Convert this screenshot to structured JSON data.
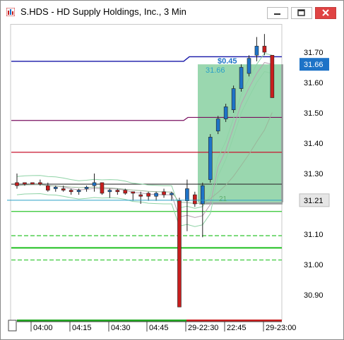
{
  "window": {
    "title": "S.HDS - HD Supply Holdings, Inc., 3 Min",
    "controls": [
      "minimize",
      "restore",
      "close"
    ]
  },
  "colors": {
    "up_candle": "#1e73c7",
    "down_candle": "#c81e1e",
    "green_zone": "#8fd3a6",
    "current_price_tag": "#1e73c7",
    "blue_line": "#1616a8",
    "purple_line": "#7a1060",
    "red_line": "#c8142d",
    "green_lines": "#2ec52e",
    "crosshair": "#2aa0c8"
  },
  "chart_data": {
    "type": "candlestick",
    "y_ticks": [
      "31.70",
      "31.60",
      "31.50",
      "31.40",
      "31.30",
      "31.10",
      "31.00",
      "30.90"
    ],
    "ylim": [
      30.85,
      31.78
    ],
    "x_ticks": [
      "04:00",
      "04:15",
      "04:30",
      "04:45",
      "29-22:30",
      "22:45",
      "29-23:00"
    ],
    "current_price": "31.66",
    "crosshair_price": "31.21",
    "annotations": {
      "gain_label": "$0.45",
      "zone_price_label": "31.66",
      "zone_count_label": "21"
    },
    "levels": [
      {
        "name": "blue-level-line",
        "value": 31.685,
        "color": "#1616a8",
        "style": "solid"
      },
      {
        "name": "purple-level-line",
        "value": 31.485,
        "color": "#7a1060",
        "style": "solid"
      },
      {
        "name": "red-level-line",
        "value": 31.37,
        "color": "#c8142d",
        "style": "solid"
      },
      {
        "name": "black-level-line",
        "value": 31.265,
        "color": "#333333",
        "style": "solid"
      },
      {
        "name": "green-level-line",
        "value": 31.175,
        "color": "#2ec52e",
        "style": "solid"
      },
      {
        "name": "green-dashed-line-1",
        "value": 31.095,
        "color": "#2ec52e",
        "style": "dashed"
      },
      {
        "name": "green-thick-line",
        "value": 31.055,
        "color": "#1fbf1f",
        "style": "solid"
      },
      {
        "name": "green-dashed-line-2",
        "value": 31.015,
        "color": "#2ec52e",
        "style": "dashed"
      }
    ],
    "candles": [
      {
        "o": 31.27,
        "h": 31.3,
        "l": 31.25,
        "c": 31.26
      },
      {
        "o": 31.27,
        "h": 31.27,
        "l": 31.26,
        "c": 31.265
      },
      {
        "o": 31.27,
        "h": 31.27,
        "l": 31.265,
        "c": 31.265
      },
      {
        "o": 31.27,
        "h": 31.28,
        "l": 31.26,
        "c": 31.265
      },
      {
        "o": 31.26,
        "h": 31.27,
        "l": 31.24,
        "c": 31.245
      },
      {
        "o": 31.25,
        "h": 31.26,
        "l": 31.24,
        "c": 31.255
      },
      {
        "o": 31.25,
        "h": 31.26,
        "l": 31.24,
        "c": 31.245
      },
      {
        "o": 31.245,
        "h": 31.25,
        "l": 31.23,
        "c": 31.24
      },
      {
        "o": 31.24,
        "h": 31.25,
        "l": 31.23,
        "c": 31.245
      },
      {
        "o": 31.25,
        "h": 31.26,
        "l": 31.24,
        "c": 31.255
      },
      {
        "o": 31.26,
        "h": 31.3,
        "l": 31.24,
        "c": 31.27
      },
      {
        "o": 31.27,
        "h": 31.27,
        "l": 31.23,
        "c": 31.235
      },
      {
        "o": 31.24,
        "h": 31.25,
        "l": 31.22,
        "c": 31.245
      },
      {
        "o": 31.245,
        "h": 31.25,
        "l": 31.23,
        "c": 31.24
      },
      {
        "o": 31.245,
        "h": 31.25,
        "l": 31.23,
        "c": 31.235
      },
      {
        "o": 31.24,
        "h": 31.24,
        "l": 31.21,
        "c": 31.235
      },
      {
        "o": 31.23,
        "h": 31.24,
        "l": 31.2,
        "c": 31.225
      },
      {
        "o": 31.235,
        "h": 31.24,
        "l": 31.21,
        "c": 31.225
      },
      {
        "o": 31.225,
        "h": 31.24,
        "l": 31.21,
        "c": 31.235
      },
      {
        "o": 31.24,
        "h": 31.25,
        "l": 31.22,
        "c": 31.23
      },
      {
        "o": 31.23,
        "h": 31.24,
        "l": 31.21,
        "c": 31.235
      },
      {
        "o": 31.21,
        "h": 31.22,
        "l": 30.86,
        "c": 30.86
      },
      {
        "o": 31.21,
        "h": 31.28,
        "l": 31.11,
        "c": 31.25
      },
      {
        "o": 31.23,
        "h": 31.24,
        "l": 31.19,
        "c": 31.2
      },
      {
        "o": 31.2,
        "h": 31.27,
        "l": 31.09,
        "c": 31.26
      },
      {
        "o": 31.28,
        "h": 31.43,
        "l": 31.27,
        "c": 31.42
      },
      {
        "o": 31.44,
        "h": 31.49,
        "l": 31.43,
        "c": 31.48
      },
      {
        "o": 31.48,
        "h": 31.53,
        "l": 31.47,
        "c": 31.52
      },
      {
        "o": 31.51,
        "h": 31.59,
        "l": 31.5,
        "c": 31.58
      },
      {
        "o": 31.58,
        "h": 31.66,
        "l": 31.57,
        "c": 31.65
      },
      {
        "o": 31.63,
        "h": 31.69,
        "l": 31.62,
        "c": 31.68
      },
      {
        "o": 31.69,
        "h": 31.75,
        "l": 31.67,
        "c": 31.72
      },
      {
        "o": 31.72,
        "h": 31.76,
        "l": 31.69,
        "c": 31.7
      },
      {
        "o": 31.69,
        "h": 31.69,
        "l": 31.55,
        "c": 31.55
      }
    ]
  }
}
